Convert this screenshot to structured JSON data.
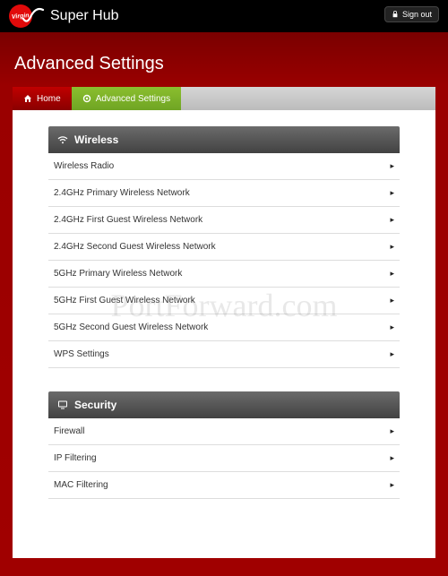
{
  "header": {
    "logo_text": "Virgin",
    "brand": "Super Hub",
    "signout": "Sign out"
  },
  "page": {
    "title": "Advanced Settings"
  },
  "tabs": {
    "home": "Home",
    "advanced": "Advanced Settings"
  },
  "sections": {
    "wireless": {
      "title": "Wireless",
      "items": [
        "Wireless Radio",
        "2.4GHz Primary Wireless Network",
        "2.4GHz First Guest Wireless Network",
        "2.4GHz Second Guest Wireless Network",
        "5GHz Primary Wireless Network",
        "5GHz First Guest Wireless Network",
        "5GHz Second Guest Wireless Network",
        "WPS Settings"
      ]
    },
    "security": {
      "title": "Security",
      "items": [
        "Firewall",
        "IP Filtering",
        "MAC Filtering"
      ]
    }
  },
  "watermark": "PortForward.com"
}
